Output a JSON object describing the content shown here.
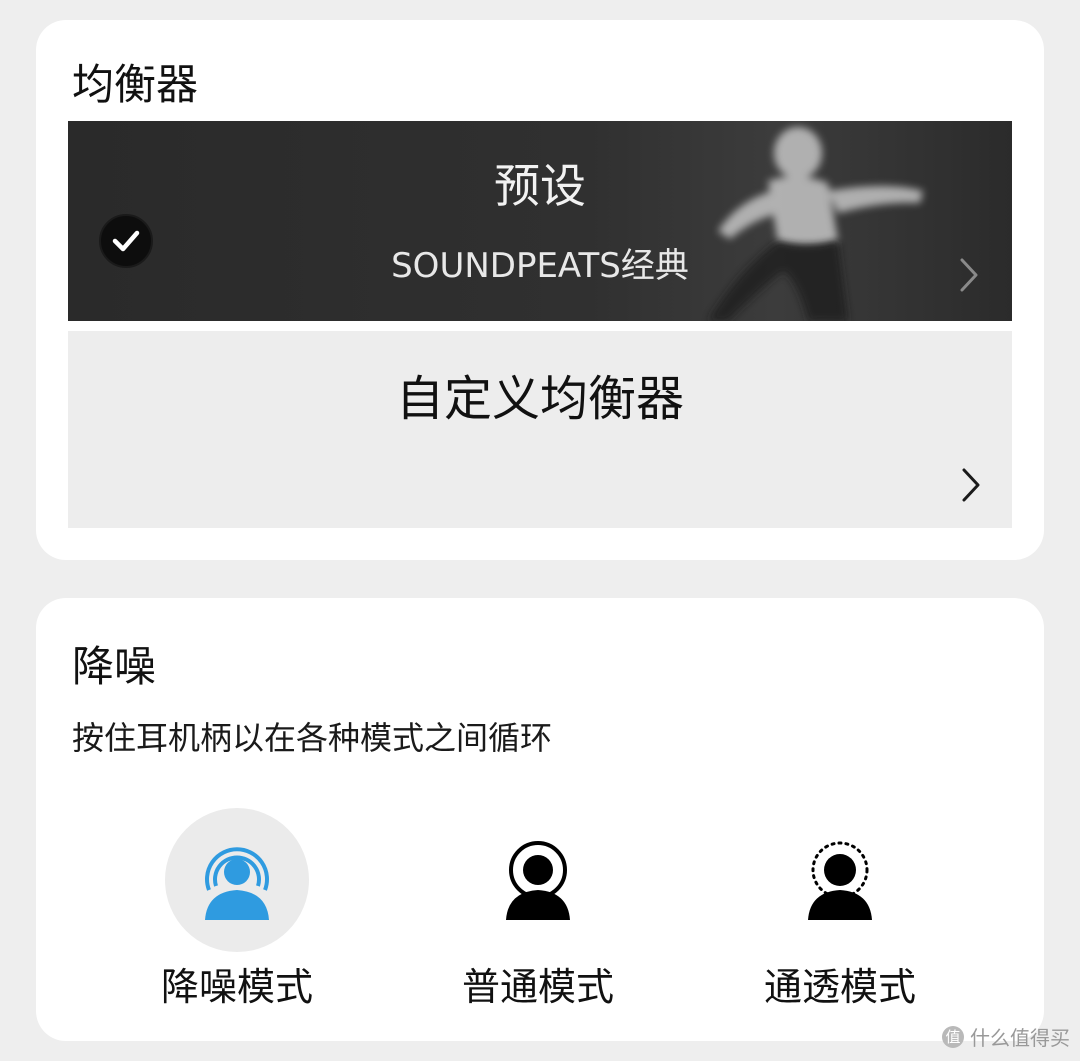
{
  "equalizer": {
    "title": "均衡器",
    "preset": {
      "title": "预设",
      "subtitle": "SOUNDPEATS经典",
      "selected": true,
      "icon": "check-icon"
    },
    "custom": {
      "title": "自定义均衡器"
    }
  },
  "noise_control": {
    "title": "降噪",
    "hint": "按住耳机柄以在各种模式之间循环",
    "modes": [
      {
        "label": "降噪模式",
        "icon": "noise-cancel-icon",
        "active": true
      },
      {
        "label": "普通模式",
        "icon": "normal-mode-icon",
        "active": false
      },
      {
        "label": "通透模式",
        "icon": "transparency-icon",
        "active": false
      }
    ]
  },
  "watermark": {
    "text": "什么值得买",
    "glyph": "值"
  },
  "colors": {
    "accent": "#2f9be0"
  }
}
